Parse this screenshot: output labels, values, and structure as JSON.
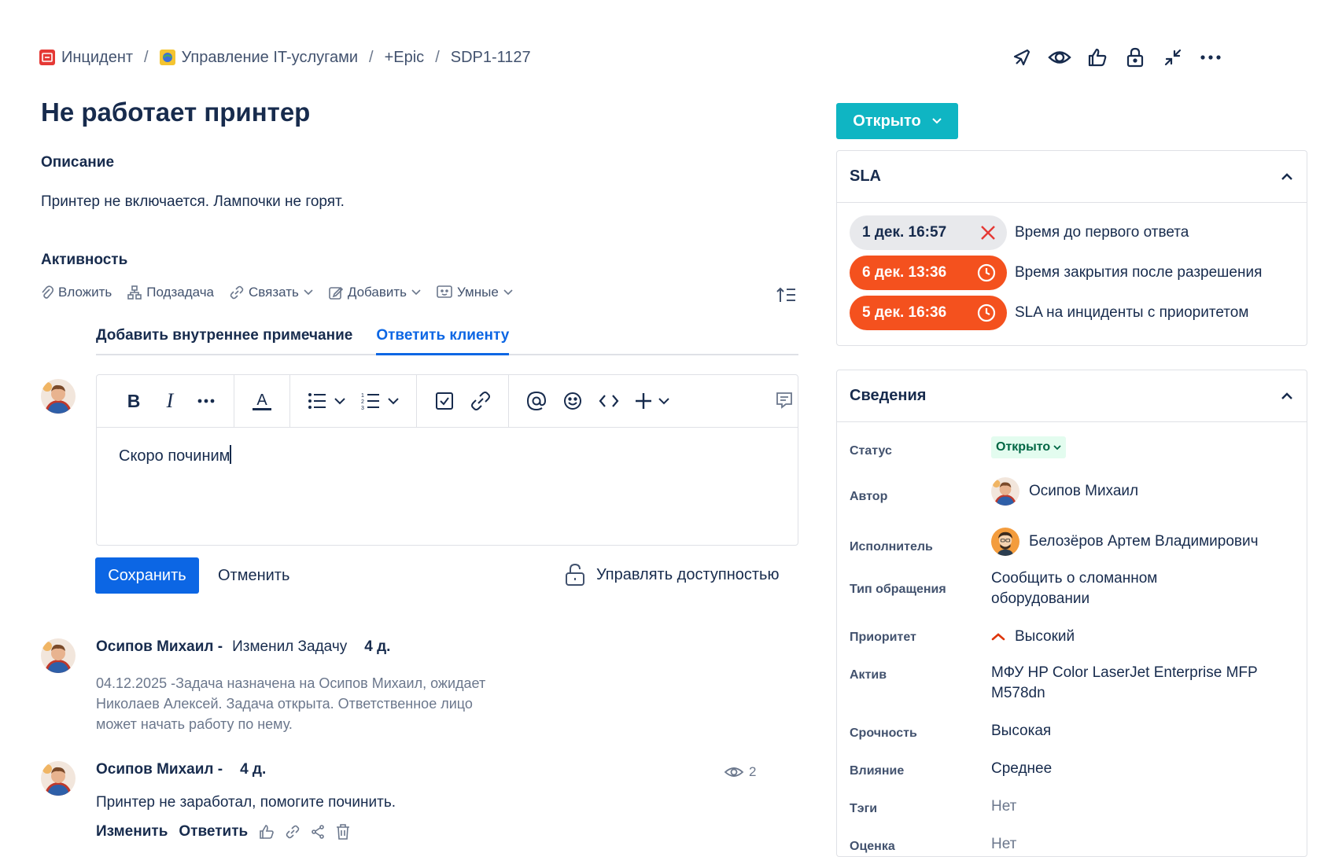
{
  "breadcrumb": {
    "items": [
      "Инцидент",
      "Управление IT-услугами",
      "+Epic",
      "SDP1-1127"
    ],
    "separator": "/"
  },
  "header_actions": [
    "feedback-icon",
    "watch-icon",
    "like-icon",
    "lock-icon",
    "collapse-icon",
    "more-icon"
  ],
  "issue": {
    "title": "Не работает принтер",
    "description_label": "Описание",
    "description": "Принтер не включается. Лампочки не горят."
  },
  "activity": {
    "label": "Активность",
    "toolbar": [
      "Вложить",
      "Подзадача",
      "Связать",
      "Добавить",
      "Умные"
    ],
    "tabs": [
      "Добавить внутреннее примечание",
      "Ответить клиенту"
    ],
    "active_tab": 1
  },
  "editor": {
    "text": "Скоро починим",
    "save_label": "Сохранить",
    "cancel_label": "Отменить",
    "access_label": "Управлять доступностью"
  },
  "entries": [
    {
      "author": "Осипов Михаил -",
      "action": "Изменил Задачу",
      "time": "4 д.",
      "lines": [
        "04.12.2025 -Задача назначена на Осипов Михаил, ожидает",
        "Николаев Алексей. Задача открыта. Ответственное лицо",
        "может начать работу по нему."
      ]
    },
    {
      "author": "Осипов Михаил -",
      "time": "4 д.",
      "views": "2",
      "text": "Принтер не заработал, помогите починить.",
      "actions": [
        "Изменить",
        "Ответить"
      ]
    }
  ],
  "status_button": "Открыто",
  "sla": {
    "title": "SLA",
    "rows": [
      {
        "time": "1 дек. 16:57",
        "label": "Время до первого ответа",
        "state": "breached"
      },
      {
        "time": "6 дек. 13:36",
        "label": "Время закрытия после разрешения",
        "state": "running"
      },
      {
        "time": "5 дек. 16:36",
        "label": "SLA на инциденты с приоритетом",
        "state": "running"
      }
    ]
  },
  "details": {
    "title": "Сведения",
    "status_label": "Статус",
    "status_value": "Открыто",
    "author_label": "Автор",
    "author_value": "Осипов Михаил",
    "assignee_label": "Исполнитель",
    "assignee_value": "Белозёров Артем Владимирович",
    "request_type_label": "Тип обращения",
    "request_type_value_1": "Сообщить о сломанном",
    "request_type_value_2": "оборудовании",
    "priority_label": "Приоритет",
    "priority_value": "Высокий",
    "asset_label": "Актив",
    "asset_value_1": "МФУ HP Color LaserJet Enterprise MFP",
    "asset_value_2": "M578dn",
    "urgency_label": "Срочность",
    "urgency_value": "Высокая",
    "impact_label": "Влияние",
    "impact_value": "Среднее",
    "tags_label": "Тэги",
    "tags_value": "Нет",
    "rating_label": "Оценка",
    "rating_value": "Нет"
  },
  "colors": {
    "primary": "#0c66e4",
    "status_teal": "#0fb5c3",
    "sla_red": "#f4511e",
    "priority_red": "#de350b"
  }
}
